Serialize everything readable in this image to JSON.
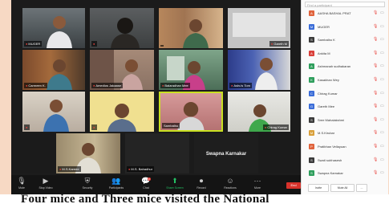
{
  "gallery": {
    "tiles": [
      {
        "name": "MUGER",
        "muted": true
      },
      {
        "name": "",
        "muted": true
      },
      {
        "name": "",
        "muted": false
      },
      {
        "name": "Gareth M",
        "muted": true
      },
      {
        "name": "Carmeen K.",
        "muted": true
      },
      {
        "name": "Amedios Jakaase",
        "muted": true
      },
      {
        "name": "Balaradhan Mee",
        "muted": true
      },
      {
        "name": "Ashu's Tom",
        "muted": true
      },
      {
        "name": "",
        "muted": true
      },
      {
        "name": "",
        "muted": true
      },
      {
        "name": "Sambalbu",
        "muted": false
      },
      {
        "name": "Chirag Kumar",
        "muted": true
      },
      {
        "name": "M.S.Kareee",
        "muted": true
      },
      {
        "name": "M.S. Bahadhur",
        "muted": true
      }
    ],
    "name_only_tile": "Swapna Karnakar"
  },
  "toolbar": {
    "items": [
      {
        "label": "Mute",
        "icon": "mic-icon"
      },
      {
        "label": "Stop Video",
        "icon": "video-icon"
      },
      {
        "label": "Security",
        "icon": "shield-icon"
      },
      {
        "label": "Participants",
        "icon": "participants-icon"
      },
      {
        "label": "Chat",
        "icon": "chat-icon"
      },
      {
        "label": "Share Screen",
        "icon": "share-screen-icon"
      },
      {
        "label": "Record",
        "icon": "record-icon"
      },
      {
        "label": "Reactions",
        "icon": "reactions-icon"
      },
      {
        "label": "More",
        "icon": "more-icon"
      }
    ],
    "chat_badge": "2",
    "end_label": "End"
  },
  "participants": {
    "search_placeholder": "Find a participant",
    "list": [
      {
        "name": "AASHA BASHAL PRAT",
        "initial": "A",
        "color": "#e0633c"
      },
      {
        "name": "MUGER",
        "initial": "M",
        "color": "#3b6dd8"
      },
      {
        "name": "Sambalbu K",
        "initial": "S",
        "color": "#3a3a3a"
      },
      {
        "name": "Ankita M",
        "initial": "A",
        "color": "#d9403a"
      },
      {
        "name": "Ashmanah sudhakaran",
        "initial": "A",
        "color": "#2e9e5c"
      },
      {
        "name": "Kasakhan Wey",
        "initial": "K",
        "color": "#2e9e5c"
      },
      {
        "name": "Chirag Kumar",
        "initial": "C",
        "color": "#3b6dd8"
      },
      {
        "name": "Gareth Mee",
        "initial": "G",
        "color": "#3b6dd8"
      },
      {
        "name": "Sree Mahalakshmi",
        "initial": "S",
        "color": "#3a3a3a"
      },
      {
        "name": "M.S.Kirubar",
        "initial": "M",
        "color": "#d9a03a"
      },
      {
        "name": "Pratibhan Vellayuan",
        "initial": "P",
        "color": "#e0633c"
      },
      {
        "name": "Swati subhasesh",
        "initial": "S",
        "color": "#3a3a3a"
      },
      {
        "name": "Swapna Karnakar",
        "initial": "S",
        "color": "#2e9e5c"
      }
    ],
    "invite_label": "Invite",
    "mute_all_label": "Mute All",
    "more_label": "..."
  },
  "caption": "Four mice and Three mice visited the National"
}
